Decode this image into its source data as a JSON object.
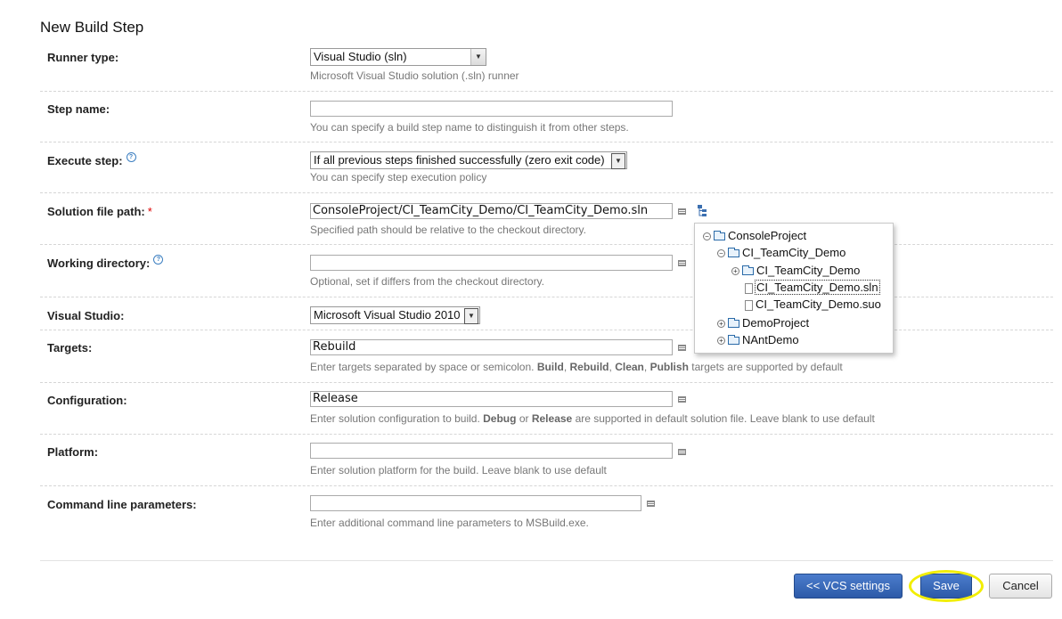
{
  "page": {
    "title": "New Build Step"
  },
  "runner_type": {
    "label": "Runner type:",
    "selected": "Visual Studio (sln)",
    "hint": "Microsoft Visual Studio solution (.sln) runner"
  },
  "step_name": {
    "label": "Step name:",
    "value": "",
    "hint": "You can specify a build step name to distinguish it from other steps."
  },
  "execute_step": {
    "label": "Execute step:",
    "selected": "If all previous steps finished successfully (zero exit code)",
    "hint": "You can specify step execution policy"
  },
  "solution_file": {
    "label": "Solution file path:",
    "required_mark": "*",
    "value": "ConsoleProject/CI_TeamCity_Demo/CI_TeamCity_Demo.sln",
    "hint": "Specified path should be relative to the checkout directory."
  },
  "working_dir": {
    "label": "Working directory:",
    "value": "",
    "hint": "Optional, set if differs from the checkout directory."
  },
  "visual_studio": {
    "label": "Visual Studio:",
    "selected": "Microsoft Visual Studio 2010"
  },
  "targets": {
    "label": "Targets:",
    "value": "Rebuild",
    "hint_pre": "Enter targets separated by space or semicolon.",
    "hint_b1": "Build",
    "hint_c1": ",",
    "hint_b2": "Rebuild",
    "hint_c2": ",",
    "hint_b3": "Clean",
    "hint_c3": ",",
    "hint_b4": "Publish",
    "hint_post": "targets are supported by default"
  },
  "configuration": {
    "label": "Configuration:",
    "value": "Release",
    "hint_pre": "Enter solution configuration to build.",
    "hint_b1": "Debug",
    "hint_mid": "or",
    "hint_b2": "Release",
    "hint_post": "are supported in default solution file. Leave blank to use default"
  },
  "platform": {
    "label": "Platform:",
    "value": "",
    "hint": "Enter solution platform for the build. Leave blank to use default"
  },
  "cmd_params": {
    "label": "Command line parameters:",
    "value": "",
    "hint": "Enter additional command line parameters to MSBuild.exe."
  },
  "tree": {
    "help_glyph": "?",
    "toggle_open": "−",
    "toggle_closed": "+",
    "nodes": [
      {
        "label": "ConsoleProject",
        "kind": "folder",
        "state": "expanded"
      },
      {
        "label": "CI_TeamCity_Demo",
        "kind": "folder",
        "state": "expanded"
      },
      {
        "label": "CI_TeamCity_Demo",
        "kind": "folder",
        "state": "collapsed"
      },
      {
        "label": "CI_TeamCity_Demo.sln",
        "kind": "file",
        "state": "selected"
      },
      {
        "label": "CI_TeamCity_Demo.suo",
        "kind": "file",
        "state": "none"
      },
      {
        "label": "DemoProject",
        "kind": "folder",
        "state": "collapsed"
      },
      {
        "label": "NAntDemo",
        "kind": "folder",
        "state": "collapsed"
      }
    ]
  },
  "buttons": {
    "vcs_settings": "<< VCS settings",
    "save": "Save",
    "cancel": "Cancel"
  },
  "colors": {
    "primary_button": "#2c5aa8",
    "highlight": "#f2ee00",
    "required": "#dd0000"
  },
  "icons": {
    "dropdown": "chevron-down-icon",
    "help": "help-icon",
    "list": "list-icon",
    "tree": "tree-browse-icon"
  }
}
